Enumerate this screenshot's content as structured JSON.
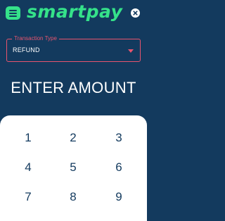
{
  "header": {
    "logo_text": "smartpay",
    "menu_icon": "menu-icon",
    "close_icon": "close-icon"
  },
  "transaction_type": {
    "label": "Transaction Type",
    "value": "REFUND",
    "dropdown_icon": "caret-down-icon"
  },
  "amount": {
    "title": "ENTER AMOUNT"
  },
  "keypad": {
    "keys": [
      "1",
      "2",
      "3",
      "4",
      "5",
      "6",
      "7",
      "8",
      "9"
    ]
  },
  "colors": {
    "background": "#133a5e",
    "brand_green": "#35e28a",
    "accent_red": "#e8546e",
    "keypad_bg": "#ffffff",
    "key_text": "#133a5e"
  }
}
